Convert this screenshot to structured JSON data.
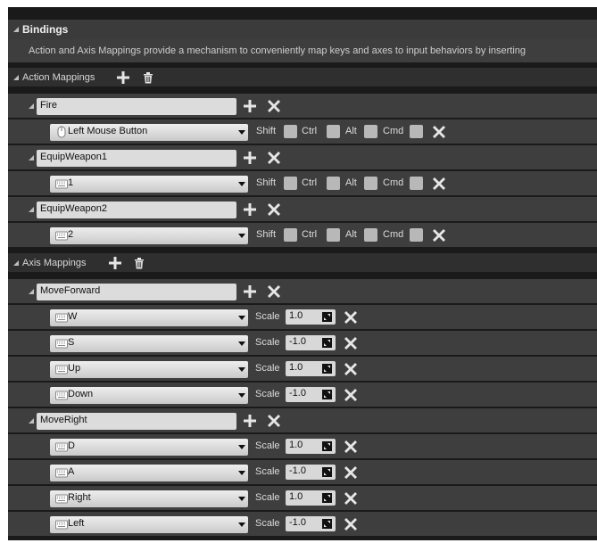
{
  "bindings": {
    "title": "Bindings",
    "description": "Action and Axis Mappings provide a mechanism to conveniently map keys and axes to input behaviors by inserting"
  },
  "action_mappings": {
    "label": "Action Mappings",
    "modifier_labels": {
      "shift": "Shift",
      "ctrl": "Ctrl",
      "alt": "Alt",
      "cmd": "Cmd"
    },
    "items": [
      {
        "name": "Fire",
        "key": "Left Mouse Button",
        "key_icon": "mouse-icon"
      },
      {
        "name": "EquipWeapon1",
        "key": "1",
        "key_icon": "keyboard-icon"
      },
      {
        "name": "EquipWeapon2",
        "key": "2",
        "key_icon": "keyboard-icon"
      }
    ]
  },
  "axis_mappings": {
    "label": "Axis Mappings",
    "scale_label": "Scale",
    "items": [
      {
        "name": "MoveForward",
        "keys": [
          {
            "key": "W",
            "scale": "1.0"
          },
          {
            "key": "S",
            "scale": "-1.0"
          },
          {
            "key": "Up",
            "scale": "1.0"
          },
          {
            "key": "Down",
            "scale": "-1.0"
          }
        ]
      },
      {
        "name": "MoveRight",
        "keys": [
          {
            "key": "D",
            "scale": "1.0"
          },
          {
            "key": "A",
            "scale": "-1.0"
          },
          {
            "key": "Right",
            "scale": "1.0"
          },
          {
            "key": "Left",
            "scale": "-1.0"
          }
        ]
      }
    ]
  },
  "colors": {
    "panel": "#3e3e3e",
    "category": "#2f2f2f",
    "background": "#1a1a1a",
    "input": "#dcdcdc"
  },
  "icons": {
    "add": "plus-icon",
    "remove": "close-icon",
    "delete": "trash-icon",
    "collapse": "collapse-triangle-icon",
    "grab": "drag-grip-icon"
  }
}
